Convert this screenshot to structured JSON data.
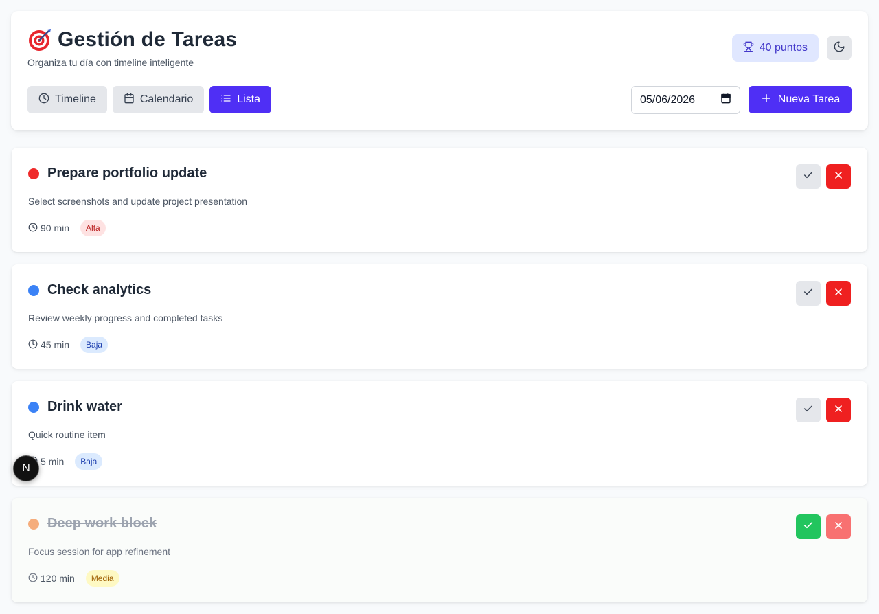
{
  "header": {
    "title": "Gestión de Tareas",
    "subtitle": "Organiza tu día con timeline inteligente",
    "points_label": "40 puntos"
  },
  "tabs": [
    {
      "label": "Timeline",
      "icon": "clock-icon",
      "active": false
    },
    {
      "label": "Calendario",
      "icon": "calendar-icon",
      "active": false
    },
    {
      "label": "Lista",
      "icon": "list-icon",
      "active": true
    }
  ],
  "date_value": "05/06/2026",
  "new_task_label": "Nueva Tarea",
  "tasks": [
    {
      "title": "Prepare portfolio update",
      "description": "Select screenshots and update project presentation",
      "duration": "90 min",
      "priority": "Alta",
      "dot_color": "#ef2a2a",
      "completed": false
    },
    {
      "title": "Check analytics",
      "description": "Review weekly progress and completed tasks",
      "duration": "45 min",
      "priority": "Baja",
      "dot_color": "#3b82f6",
      "completed": false
    },
    {
      "title": "Drink water",
      "description": "Quick routine item",
      "duration": "5 min",
      "priority": "Baja",
      "dot_color": "#3b82f6",
      "completed": false
    },
    {
      "title": "Deep work block",
      "description": "Focus session for app refinement",
      "duration": "120 min",
      "priority": "Media",
      "dot_color": "#f5ad7c",
      "completed": true
    }
  ],
  "dev_badge_letter": "N",
  "colors": {
    "accent": "#4f2ff5",
    "delete": "#ef2020",
    "complete": "#22c55e"
  }
}
